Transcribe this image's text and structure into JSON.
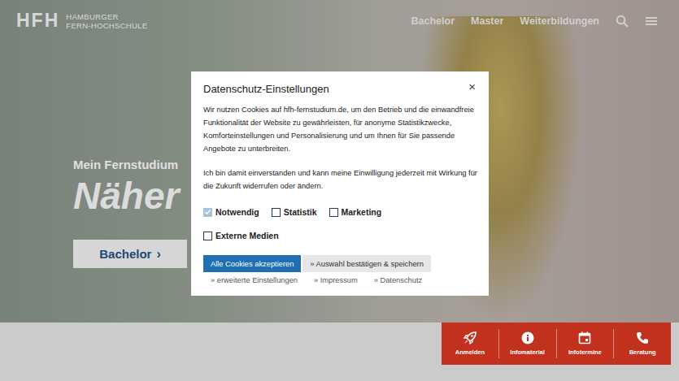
{
  "header": {
    "logo_mark": "HFH",
    "logo_text": [
      "HAMBURGER",
      "FERN-HOCHSCHULE"
    ],
    "nav": [
      "Bachelor",
      "Master",
      "Weiterbildungen"
    ]
  },
  "hero": {
    "kicker": "Mein Fernstudium",
    "headline": "Näher",
    "button": {
      "label": "Bachelor",
      "arrow": "›"
    }
  },
  "quick_actions": [
    {
      "label": "Anmelden",
      "icon": "rocket"
    },
    {
      "label": "Infomaterial",
      "icon": "info"
    },
    {
      "label": "Infotermine",
      "icon": "calendar"
    },
    {
      "label": "Beratung",
      "icon": "phone"
    }
  ],
  "dialog": {
    "title": "Datenschutz-Einstellungen",
    "close": "×",
    "paragraphs": [
      "Wir nutzen Cookies auf hfh-fernstudium.de, um den Betrieb und die einwandfreie Funktionalität der Website zu gewährleisten, für anonyme Statistikzwecke, Komforteinstellungen und Personalisierung und um Ihnen für Sie passende Angebote zu unterbreiten.",
      "Ich bin damit einverstanden und kann meine Einwilligung jederzeit mit Wirkung für die Zukunft widerrufen oder ändern."
    ],
    "option_rows": [
      [
        {
          "label": "Notwendig",
          "checked": true,
          "disabled": true
        },
        {
          "label": "Statistik",
          "checked": false,
          "disabled": false
        },
        {
          "label": "Marketing",
          "checked": false,
          "disabled": false
        }
      ],
      [
        {
          "label": "Externe Medien",
          "checked": false,
          "disabled": false
        }
      ]
    ],
    "buttons": [
      {
        "label": "Alle Cookies akzeptieren",
        "primary": true
      },
      {
        "label": "» Auswahl bestätigen & speichern",
        "primary": false
      }
    ],
    "links": [
      "» erweiterte Einstellungen",
      "» Impressum",
      "» Datenschutz"
    ]
  }
}
